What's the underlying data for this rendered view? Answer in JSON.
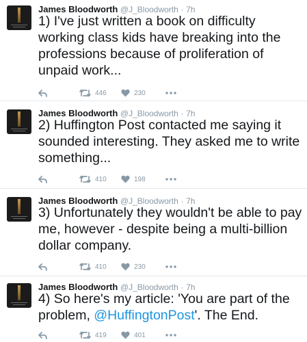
{
  "tweets": [
    {
      "author": "James Bloodworth",
      "handle": "@J_Bloodworth",
      "separator": "·",
      "time": "7h",
      "text": "1) I've just written a book on difficulty working class kids have breaking into the professions because of proliferation of unpaid work...",
      "retweets": "446",
      "likes": "230"
    },
    {
      "author": "James Bloodworth",
      "handle": "@J_Bloodworth",
      "separator": "·",
      "time": "7h",
      "text": "2) Huffington Post contacted me saying it sounded interesting. They asked me to write something...",
      "retweets": "410",
      "likes": "198"
    },
    {
      "author": "James Bloodworth",
      "handle": "@J_Bloodworth",
      "separator": "·",
      "time": "7h",
      "text": "3) Unfortunately they wouldn't be able to pay me, however - despite being a multi-billion dollar company.",
      "retweets": "410",
      "likes": "230"
    },
    {
      "author": "James Bloodworth",
      "handle": "@J_Bloodworth",
      "separator": "·",
      "time": "7h",
      "text_before": "4) So here's my article: 'You are part of the problem, ",
      "mention": "@HuffingtonPost",
      "text_after": "'. The End.",
      "retweets": "419",
      "likes": "401"
    }
  ],
  "icons": {
    "reply": "reply-icon",
    "retweet": "retweet-icon",
    "like": "heart-icon",
    "more": "more-icon"
  },
  "colors": {
    "text": "#14171a",
    "muted": "#8899a6",
    "link": "#1b95e0",
    "divider": "#e1e8ed"
  }
}
